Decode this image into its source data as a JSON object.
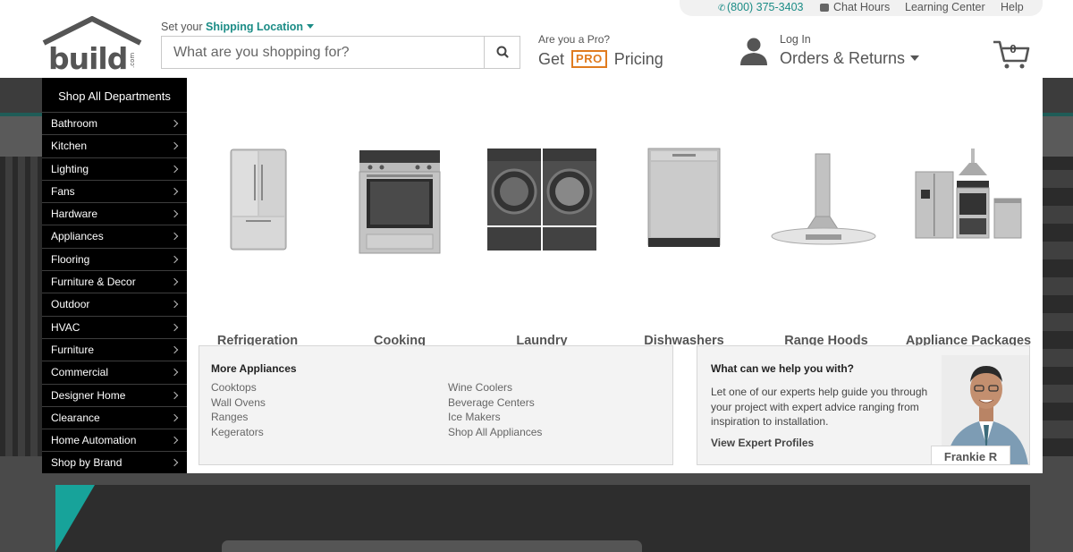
{
  "utility_bar": {
    "phone": "(800) 375-3403",
    "chat": "Chat Hours",
    "learning": "Learning Center",
    "help": "Help"
  },
  "logo": {
    "text": "build",
    "suffix": ".com"
  },
  "shipping": {
    "prefix": "Set your",
    "link": "Shipping Location"
  },
  "search": {
    "placeholder": "What are you shopping for?",
    "value": ""
  },
  "pro": {
    "question": "Are you a Pro?",
    "get": "Get",
    "badge": "PRO",
    "pricing": "Pricing"
  },
  "account": {
    "login": "Log In",
    "orders": "Orders & Returns"
  },
  "cart": {
    "count": "0"
  },
  "departments": {
    "title": "Shop All Departments",
    "items": [
      "Bathroom",
      "Kitchen",
      "Lighting",
      "Fans",
      "Hardware",
      "Appliances",
      "Flooring",
      "Furniture & Decor",
      "Outdoor",
      "HVAC",
      "Furniture",
      "Commercial",
      "Designer Home",
      "Clearance",
      "Home Automation",
      "Shop by Brand"
    ]
  },
  "categories": [
    {
      "label": "Refrigeration",
      "icon": "refrigerator-image"
    },
    {
      "label": "Cooking",
      "icon": "range-oven-image"
    },
    {
      "label": "Laundry",
      "icon": "washer-dryer-image"
    },
    {
      "label": "Dishwashers",
      "icon": "dishwasher-image"
    },
    {
      "label": "Range Hoods",
      "icon": "range-hood-image"
    },
    {
      "label": "Appliance Packages",
      "icon": "appliance-package-image"
    }
  ],
  "more_appliances": {
    "title": "More Appliances",
    "col1": [
      "Cooktops",
      "Wall Ovens",
      "Ranges",
      "Kegerators"
    ],
    "col2": [
      "Wine Coolers",
      "Beverage Centers",
      "Ice Makers",
      "Shop All Appliances"
    ]
  },
  "help": {
    "title": "What can we help you with?",
    "text": "Let one of our experts help guide you through your project with expert advice ranging from inspiration to installation.",
    "link": "View Expert Profiles",
    "expert_name": "Frankie R"
  },
  "colors": {
    "accent": "#1b8c86",
    "pro": "#e07b1f",
    "menu_bg": "#000000"
  }
}
